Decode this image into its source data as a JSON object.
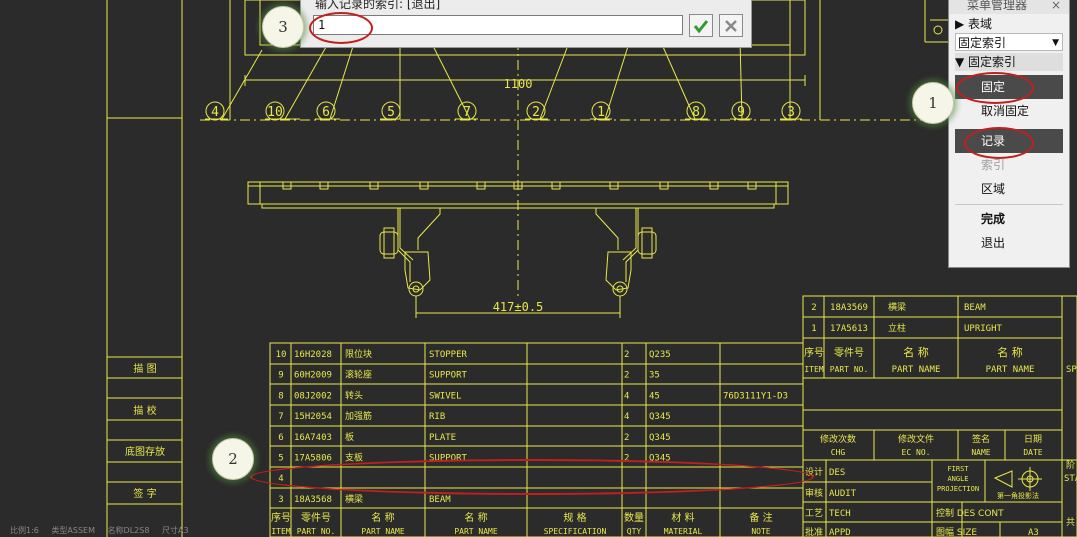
{
  "dialog": {
    "prompt": "输入记录的索引: [退出]",
    "input_value": "1",
    "ok_icon": "check-icon",
    "cancel_icon": "close-icon"
  },
  "menu": {
    "title": "菜单管理器",
    "close_glyph": "×",
    "table_domain": "▶ 表域",
    "selected_index": "固定索引",
    "section": "▼ 固定索引",
    "items": [
      "固定",
      "取消固定",
      "记录",
      "索引",
      "区域",
      "完成",
      "退出"
    ]
  },
  "callouts": [
    "1",
    "2",
    "3"
  ],
  "drawing": {
    "dimension_top": "1100",
    "dimension_mid": "417±0.5",
    "balloons": [
      "4",
      "10",
      "6",
      "5",
      "7",
      "2",
      "1",
      "8",
      "9",
      "3"
    ],
    "side_labels": [
      "描  图",
      "描  校",
      "底图存放",
      "签  字"
    ],
    "bom_rows": [
      [
        "10",
        "16H2028",
        "限位块",
        "STOPPER",
        "2",
        "Q235",
        ""
      ],
      [
        "9",
        "60H2009",
        "滚轮座",
        "SUPPORT",
        "2",
        "35",
        ""
      ],
      [
        "8",
        "08J2002",
        "转头",
        "SWIVEL",
        "4",
        "45",
        "76D3111Y1-D3"
      ],
      [
        "7",
        "15H2054",
        "加强筋",
        "RIB",
        "4",
        "Q345",
        ""
      ],
      [
        "6",
        "16A7403",
        "板",
        "PLATE",
        "2",
        "Q345",
        ""
      ],
      [
        "5",
        "17A5806",
        "支板",
        "SUPPORT",
        "2",
        "Q345",
        ""
      ],
      [
        "4",
        "",
        "",
        "",
        "",
        "",
        ""
      ],
      [
        "3",
        "18A3568",
        "横梁",
        "BEAM",
        "",
        "",
        ""
      ]
    ],
    "bom_header_cn": [
      "序号",
      "零件号",
      "名  称",
      "名  称",
      "规  格",
      "数量",
      "材  料",
      "备  注"
    ],
    "bom_header_en": [
      "ITEM",
      "PART NO.",
      "PART NAME",
      "PART NAME",
      "SPECIFICATION",
      "QTY",
      "MATERIAL",
      "NOTE"
    ],
    "right_rows": [
      [
        "2",
        "18A3569",
        "横梁",
        "BEAM"
      ],
      [
        "1",
        "17A5613",
        "立柱",
        "UPRIGHT"
      ]
    ],
    "right_header_cn": [
      "序号",
      "零件号",
      "名  称",
      "名  称"
    ],
    "right_header_en": [
      "ITEM",
      "PART NO.",
      "PART NAME",
      "PART NAME"
    ],
    "right_header_extra": "SP",
    "revision_cn": [
      "修改次数",
      "修改文件",
      "签名",
      "日期"
    ],
    "revision_en": [
      "CHG",
      "EC NO.",
      "NAME",
      "DATE"
    ],
    "sign_rows": [
      [
        "设计",
        "DES"
      ],
      [
        "审核",
        "AUDIT"
      ],
      [
        "工艺",
        "TECH"
      ],
      [
        "批准",
        "APPD"
      ]
    ],
    "projection_label": [
      "FIRST",
      "ANGLE",
      "PROJECTION"
    ],
    "projection_note": "第一角投影法",
    "control_label": "控制 DES CONT",
    "size_label": "图幅  SIZE",
    "size_value": "A3",
    "stage_label": "阶",
    "stage_en": "STA",
    "total_label": "共"
  },
  "statusbar": [
    "比例1:6",
    "类型ASSEM",
    "名称DL2S8",
    "尺寸A3"
  ]
}
